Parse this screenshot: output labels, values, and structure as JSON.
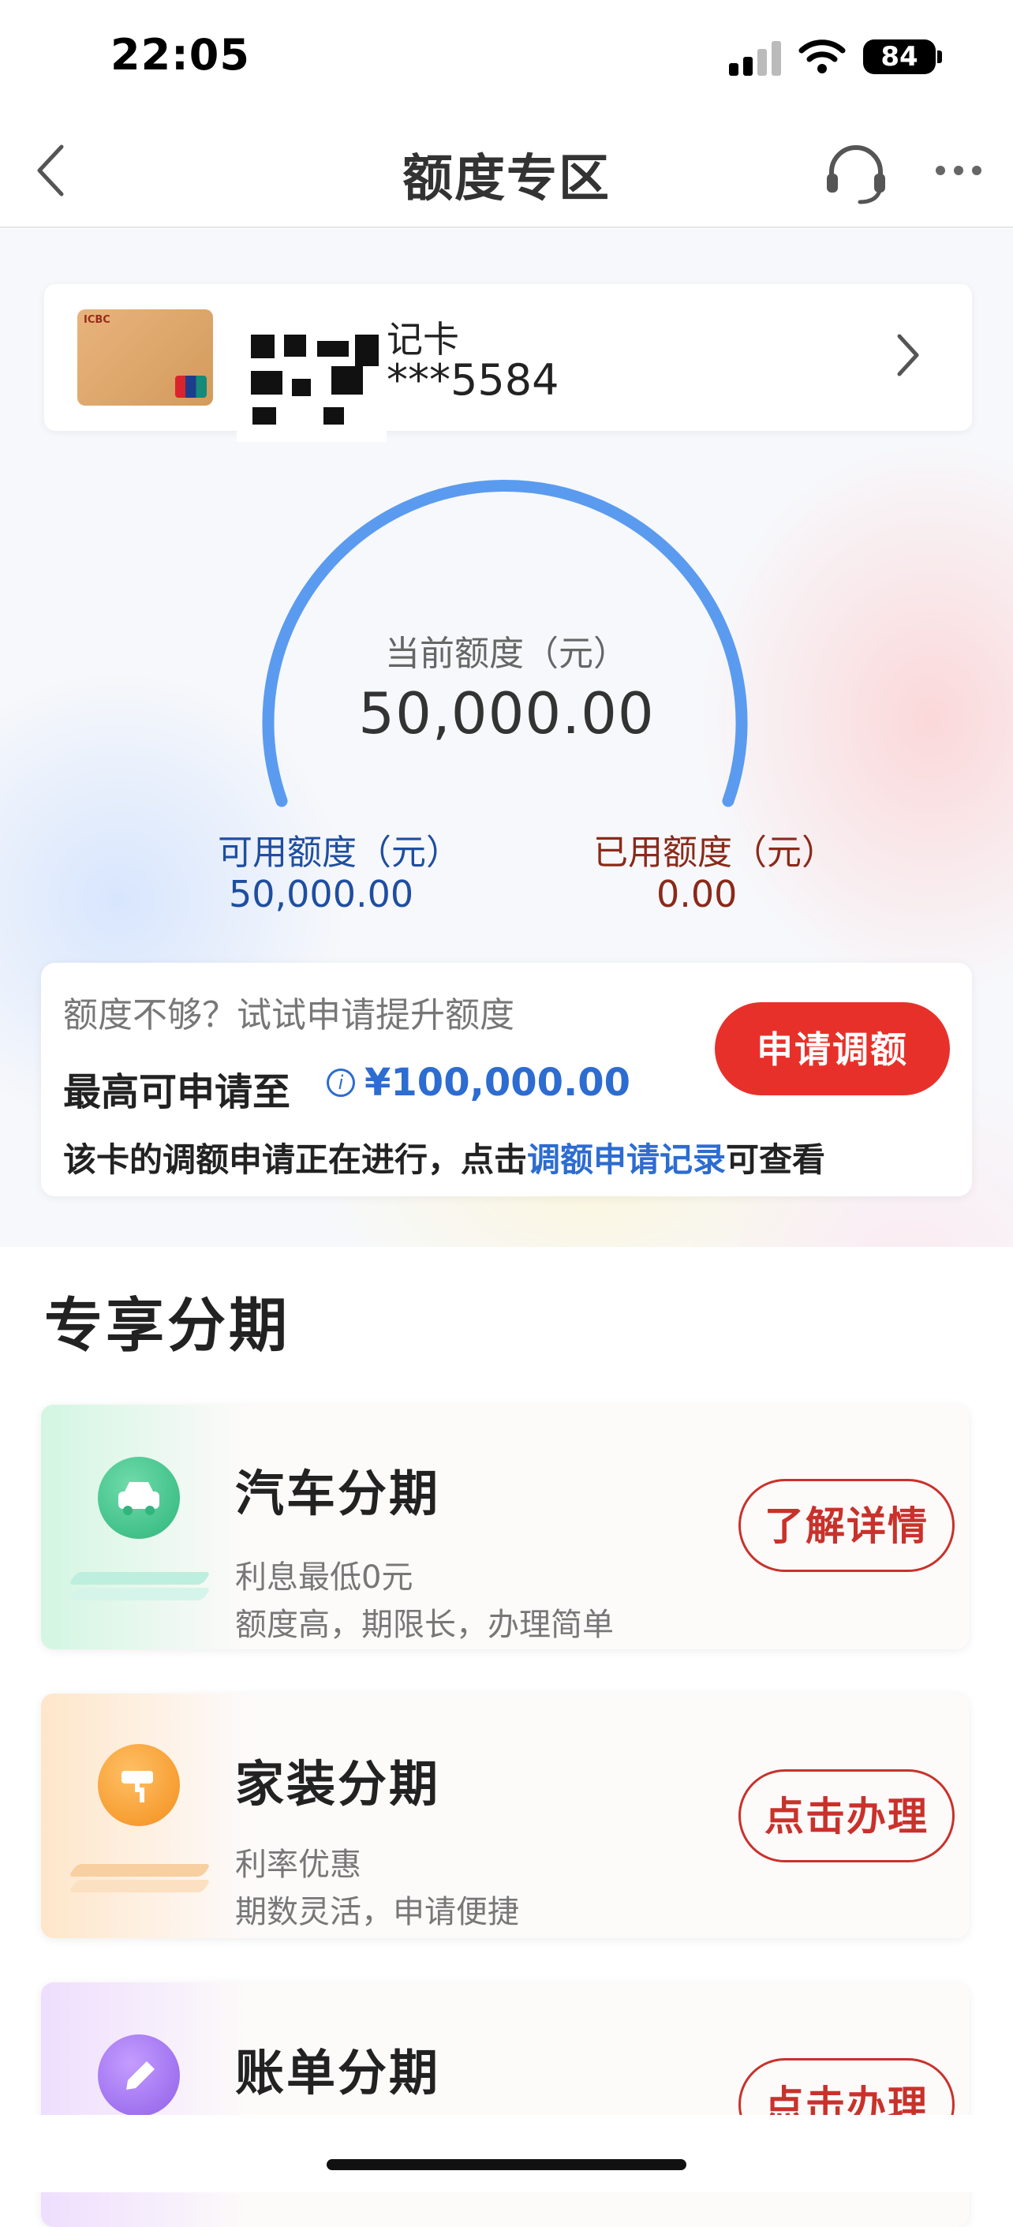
{
  "status_bar": {
    "time": "22:05",
    "battery": "84"
  },
  "nav": {
    "title": "额度专区"
  },
  "card": {
    "name_suffix": "记卡",
    "number": "***5584"
  },
  "credit": {
    "current_label": "当前额度（元）",
    "current_value": "50,000.00",
    "available_label": "可用额度（元）",
    "available_value": "50,000.00",
    "used_label": "已用额度（元）",
    "used_value": "0.00"
  },
  "apply": {
    "hint": "额度不够？试试申请提升额度",
    "max_label": "最高可申请至",
    "max_value": "¥100,000.00",
    "status_prefix": "该卡的调额申请正在进行，点击",
    "status_link": "调额申请记录",
    "status_suffix": "可查看",
    "button": "申请调额"
  },
  "section": {
    "title": "专享分期"
  },
  "installments": [
    {
      "title": "汽车分期",
      "line1": "利息最低0元",
      "line2": "额度高，期限长，办理简单",
      "button": "了解详情",
      "icon": "car-icon"
    },
    {
      "title": "家装分期",
      "line1": "利率优惠",
      "line2": "期数灵活，申请便捷",
      "button": "点击办理",
      "icon": "paint-roller-icon"
    },
    {
      "title": "账单分期",
      "button": "点击办理",
      "icon": "pen-icon"
    }
  ],
  "colors": {
    "accent_red": "#e8302a",
    "link_blue": "#2d6cd0",
    "gauge_blue": "#5a9bf0"
  }
}
